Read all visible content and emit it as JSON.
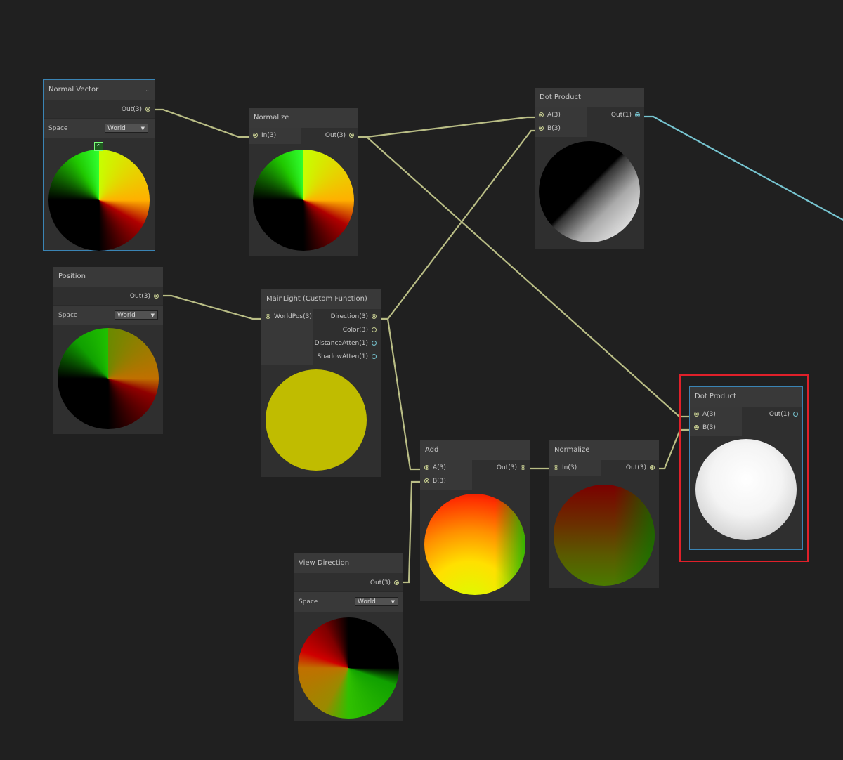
{
  "nodes": {
    "normal_vector": {
      "title": "Normal Vector",
      "out": "Out(3)",
      "space_label": "Space",
      "space_value": "World"
    },
    "normalize1": {
      "title": "Normalize",
      "in": "In(3)",
      "out": "Out(3)"
    },
    "dot1": {
      "title": "Dot Product",
      "a": "A(3)",
      "b": "B(3)",
      "out": "Out(1)"
    },
    "position": {
      "title": "Position",
      "out": "Out(3)",
      "space_label": "Space",
      "space_value": "World"
    },
    "mainlight": {
      "title": "MainLight (Custom Function)",
      "in": "WorldPos(3)",
      "outs": [
        "Direction(3)",
        "Color(3)",
        "DistanceAtten(1)",
        "ShadowAtten(1)"
      ]
    },
    "add": {
      "title": "Add",
      "a": "A(3)",
      "b": "B(3)",
      "out": "Out(3)"
    },
    "normalize2": {
      "title": "Normalize",
      "in": "In(3)",
      "out": "Out(3)"
    },
    "dot2": {
      "title": "Dot Product",
      "a": "A(3)",
      "b": "B(3)",
      "out": "Out(1)"
    },
    "view_direction": {
      "title": "View Direction",
      "out": "Out(3)",
      "space_label": "Space",
      "space_value": "World"
    }
  },
  "colors": {
    "background": "#202020",
    "wire_vec3": "#b9bd85",
    "wire_vec1": "#76c4d0",
    "highlight": "#e0202a",
    "selection": "#3a84b4"
  },
  "icons": {
    "expand": "chevron-up-icon",
    "dropdown": "caret-down-icon",
    "collapse": "chevron-down-icon"
  }
}
